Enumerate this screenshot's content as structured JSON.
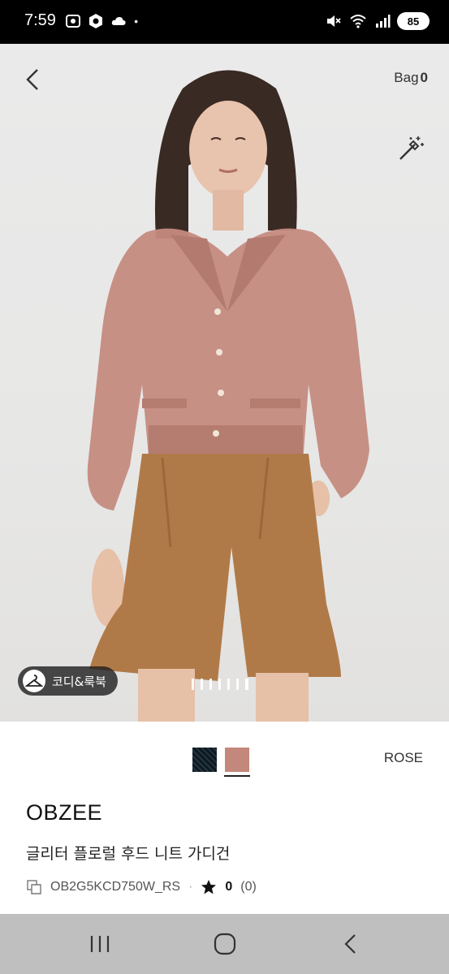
{
  "status_bar": {
    "time": "7:59",
    "battery": "85",
    "left_icons": [
      "screen-record-icon",
      "app-hexagon-icon",
      "cloud-icon",
      "dot-icon"
    ],
    "right_icons": [
      "mute-icon",
      "wifi-icon",
      "signal-icon",
      "battery-icon"
    ]
  },
  "header": {
    "bag_label": "Bag",
    "bag_count": "0"
  },
  "hero": {
    "coordination_button": "코디&룩북",
    "page_count": 7,
    "active_page": 4
  },
  "product": {
    "selected_color": "ROSE",
    "swatches": [
      {
        "name": "black",
        "color": "#0d1a22"
      },
      {
        "name": "rose",
        "color": "#c4877b"
      }
    ],
    "brand": "OBZEE",
    "name": "글리터 플로럴 후드 니트 가디건",
    "code": "OB2G5KCD750W_RS",
    "separator": "·",
    "rating": "0",
    "review_count": "(0)"
  },
  "colors": {
    "status_bg": "#000000",
    "nav_bg": "#bfbfbf",
    "cardigan": "#c58b80",
    "shorts": "#b07a48"
  }
}
